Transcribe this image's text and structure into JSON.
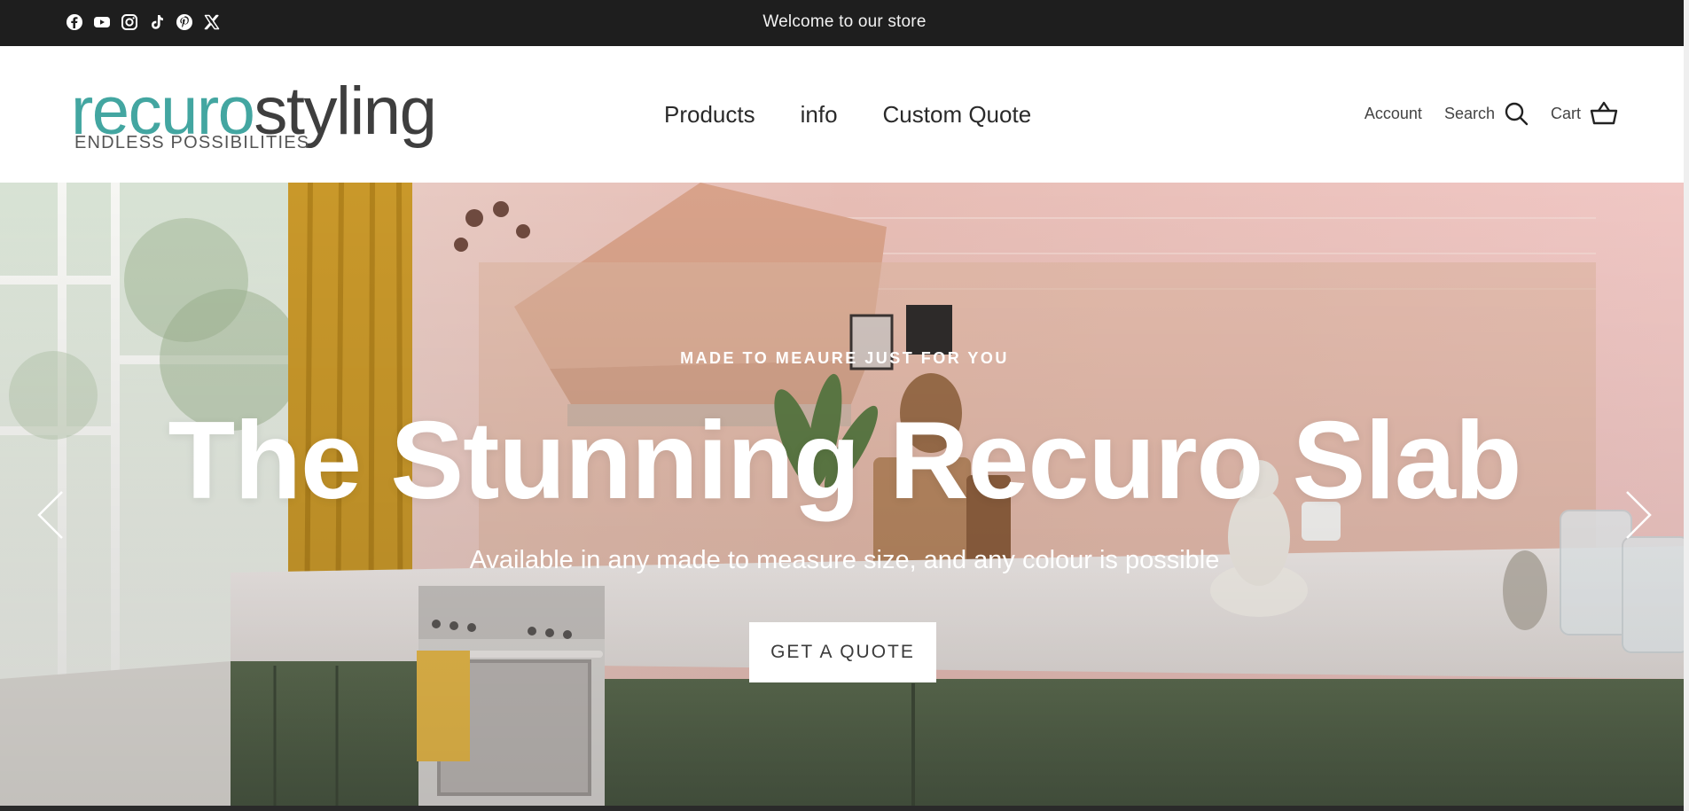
{
  "announcement": {
    "text": "Welcome to our store",
    "socials": [
      "facebook-icon",
      "youtube-icon",
      "instagram-icon",
      "tiktok-icon",
      "pinterest-icon",
      "x-icon"
    ]
  },
  "header": {
    "logo": {
      "part1": "recuro",
      "part2": "styling",
      "tagline": "ENDLESS POSSIBILITIES"
    },
    "nav": [
      {
        "label": "Products"
      },
      {
        "label": "info"
      },
      {
        "label": "Custom Quote"
      }
    ],
    "utility": {
      "account": "Account",
      "search": "Search",
      "cart": "Cart"
    }
  },
  "hero": {
    "eyebrow": "MADE TO MEAURE JUST FOR YOU",
    "headline": "The Stunning Recuro Slab",
    "subline": "Available in any made to measure size, and any colour is possible",
    "cta": "GET A QUOTE"
  },
  "colors": {
    "topbar": "#1e1e1e",
    "logo_teal": "#43a6a1",
    "logo_dark": "#3e3e3e",
    "cta_bg": "#ffffff"
  }
}
